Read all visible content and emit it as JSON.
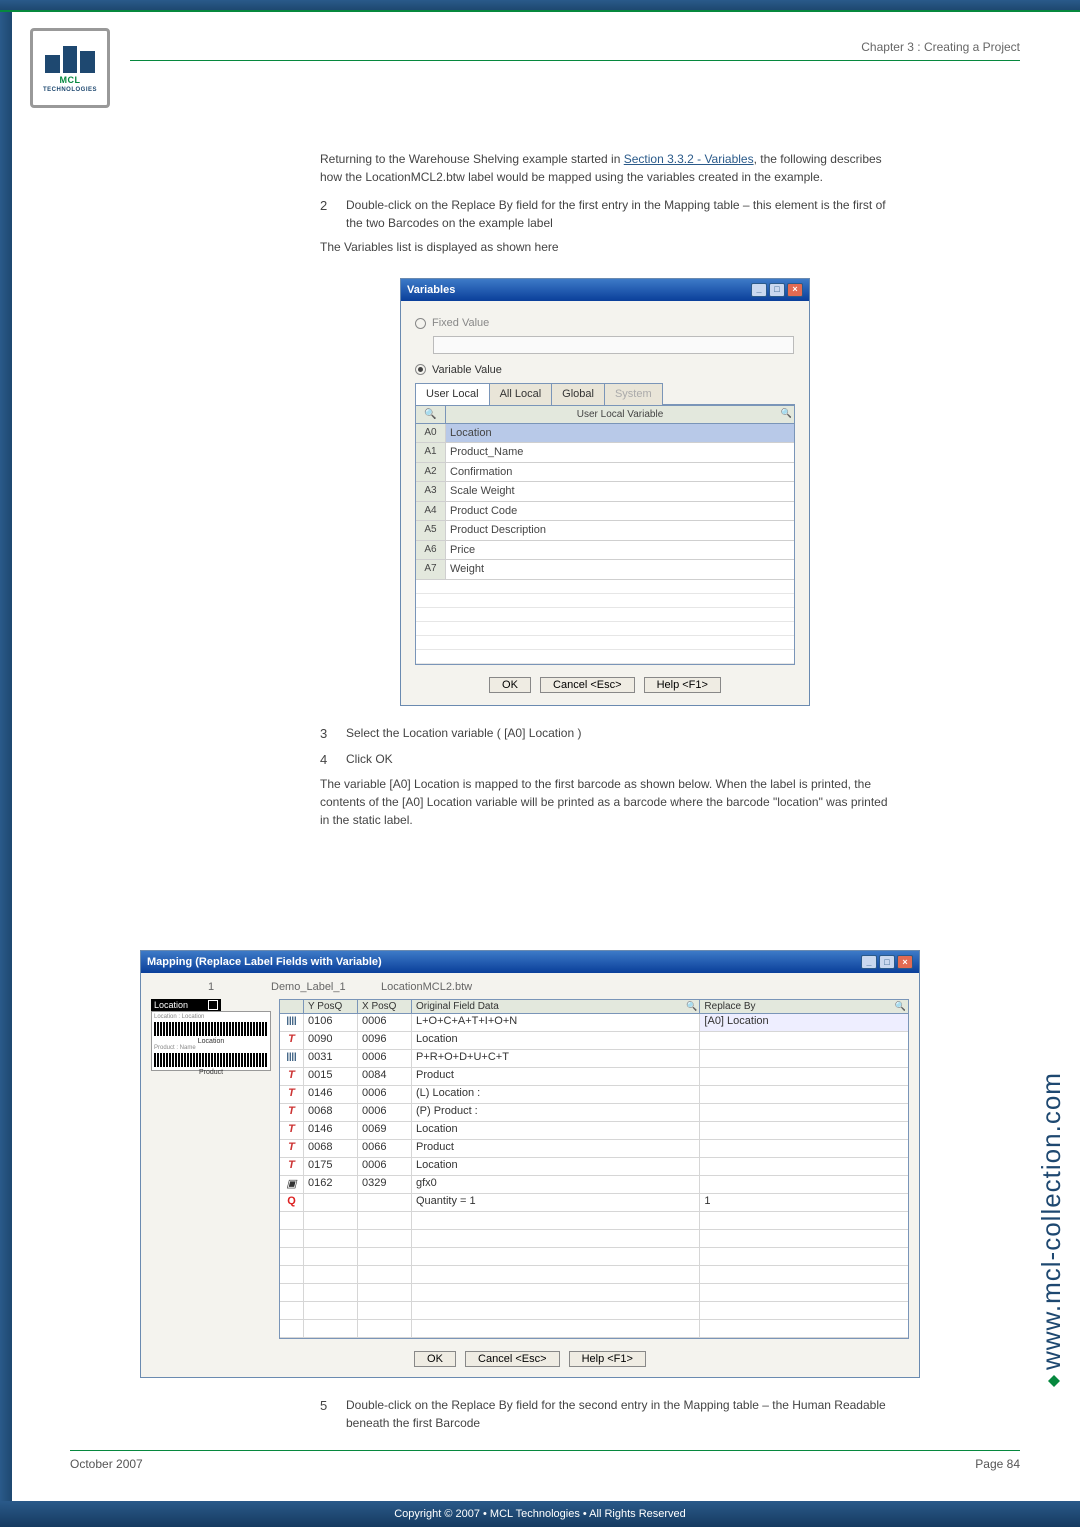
{
  "header": {
    "chapter": "Chapter 3 : Creating a Project"
  },
  "logo": {
    "brand_top": "MCL",
    "brand_bottom": "TECHNOLOGIES"
  },
  "intro": {
    "p1a": "Returning to the Warehouse Shelving example started in ",
    "p1link": "Section 3.3.2 - Variables",
    "p1b": ", the following describes how the LocationMCL2.btw label would be mapped using the variables created in the example."
  },
  "steps": {
    "s2num": "2",
    "s2txt": "Double-click on the Replace By field for the first entry in the Mapping table – this element is the first of the two Barcodes on the example label",
    "afterS2": "The Variables list is displayed as shown here",
    "s3num": "3",
    "s3txt": "Select the Location variable ( [A0] Location )",
    "s4num": "4",
    "s4txt": "Click OK",
    "afterS4": "The variable [A0] Location is mapped to the first barcode as shown below. When the label is printed, the contents of the [A0] Location variable will be printed as a barcode where the barcode \"location\" was printed in the static label.",
    "s5num": "5",
    "s5txt": "Double-click on the Replace By field for the second entry in the Mapping table – the Human Readable beneath the first Barcode"
  },
  "variablesWindow": {
    "title": "Variables",
    "radioFixed": "Fixed Value",
    "radioVariable": "Variable Value",
    "tabs": {
      "t1": "User Local",
      "t2": "All Local",
      "t3": "Global",
      "t4": "System"
    },
    "header": {
      "c1": "",
      "c2": "User Local Variable"
    },
    "rows": [
      {
        "id": "A0",
        "name": "Location"
      },
      {
        "id": "A1",
        "name": "Product_Name"
      },
      {
        "id": "A2",
        "name": "Confirmation"
      },
      {
        "id": "A3",
        "name": "Scale Weight"
      },
      {
        "id": "A4",
        "name": "Product Code"
      },
      {
        "id": "A5",
        "name": "Product Description"
      },
      {
        "id": "A6",
        "name": "Price"
      },
      {
        "id": "A7",
        "name": "Weight"
      }
    ],
    "buttons": {
      "ok": "OK",
      "cancel": "Cancel <Esc>",
      "help": "Help <F1>"
    }
  },
  "mappingWindow": {
    "title": "Mapping (Replace Label Fields with Variable)",
    "top": {
      "num": "1",
      "label": "Demo_Label_1",
      "file": "LocationMCL2.btw"
    },
    "preview": {
      "blackLabel": "Location",
      "cap1": "Location",
      "cap2": "Product",
      "smallhdr": "Location : Location",
      "smallhdr2": "Product : Name"
    },
    "cols": {
      "yp": "Y PosQ",
      "xp": "X PosQ",
      "of": "Original Field Data",
      "rb": "Replace By"
    },
    "rows": [
      {
        "ico": "bar",
        "y": "0106",
        "x": "0006",
        "of": "L+O+C+A+T+I+O+N",
        "rb": "[A0] Location"
      },
      {
        "ico": "T",
        "y": "0090",
        "x": "0096",
        "of": "Location",
        "rb": ""
      },
      {
        "ico": "bar",
        "y": "0031",
        "x": "0006",
        "of": "P+R+O+D+U+C+T",
        "rb": ""
      },
      {
        "ico": "T",
        "y": "0015",
        "x": "0084",
        "of": "Product",
        "rb": ""
      },
      {
        "ico": "T",
        "y": "0146",
        "x": "0006",
        "of": "(L) Location :",
        "rb": ""
      },
      {
        "ico": "T",
        "y": "0068",
        "x": "0006",
        "of": "(P) Product :",
        "rb": ""
      },
      {
        "ico": "T",
        "y": "0146",
        "x": "0069",
        "of": "Location",
        "rb": ""
      },
      {
        "ico": "T",
        "y": "0068",
        "x": "0066",
        "of": "Product",
        "rb": ""
      },
      {
        "ico": "T",
        "y": "0175",
        "x": "0006",
        "of": "Location",
        "rb": ""
      },
      {
        "ico": "img",
        "y": "0162",
        "x": "0329",
        "of": "gfx0",
        "rb": ""
      },
      {
        "ico": "Q",
        "y": "",
        "x": "",
        "of": "Quantity = 1",
        "rb": "1"
      }
    ],
    "buttons": {
      "ok": "OK",
      "cancel": "Cancel <Esc>",
      "help": "Help <F1>"
    }
  },
  "sideUrl": "www.mcl-collection.com",
  "footer": {
    "date": "October 2007",
    "page": "Page   84"
  },
  "copyright": "Copyright © 2007 • MCL Technologies • All Rights Reserved"
}
